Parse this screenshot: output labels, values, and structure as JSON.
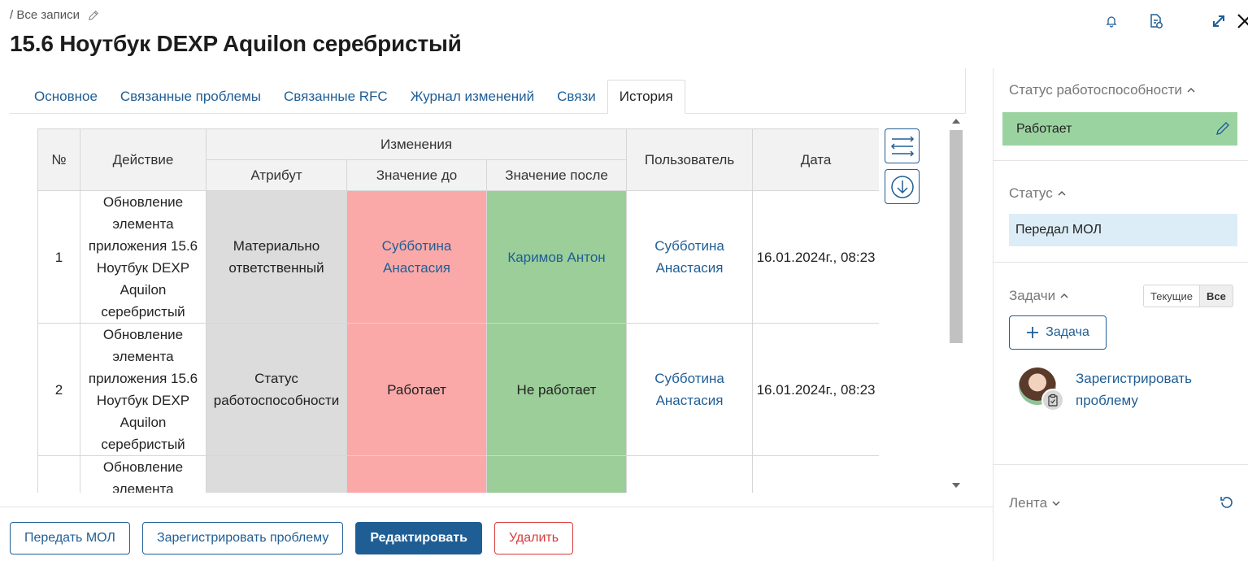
{
  "breadcrumb": {
    "text": "/ Все записи"
  },
  "title": "15.6 Ноутбук DEXP Aquilon серебристый",
  "tabs": [
    {
      "label": "Основное"
    },
    {
      "label": "Связанные проблемы"
    },
    {
      "label": "Связанные RFC"
    },
    {
      "label": "Журнал изменений"
    },
    {
      "label": "Связи"
    },
    {
      "label": "История"
    }
  ],
  "table": {
    "headers": {
      "num": "№",
      "action": "Действие",
      "changes": "Изменения",
      "attribute": "Атрибут",
      "before": "Значение до",
      "after": "Значение после",
      "user": "Пользователь",
      "date": "Дата"
    },
    "rows": [
      {
        "num": "1",
        "action": "Обновление элемента приложения 15.6 Ноутбук DEXP Aquilon серебристый",
        "attribute": "Материально ответственный",
        "before": "Субботина Анастасия",
        "after": "Каримов Антон",
        "user": "Субботина Анастасия",
        "date": "16.01.2024г., 08:23"
      },
      {
        "num": "2",
        "action": "Обновление элемента приложения 15.6 Ноутбук DEXP Aquilon серебристый",
        "attribute": "Статус работоспособности",
        "before": "Работает",
        "after": "Не работает",
        "user": "Субботина Анастасия",
        "date": "16.01.2024г., 08:23"
      },
      {
        "num": "",
        "action": "Обновление элемента",
        "attribute": "",
        "before": "",
        "after": "",
        "user": "",
        "date": ""
      }
    ]
  },
  "actions": {
    "transfer": "Передать МОЛ",
    "register": "Зарегистрировать проблему",
    "edit": "Редактировать",
    "delete": "Удалить"
  },
  "right_panel": {
    "health": {
      "title": "Статус работоспособности",
      "value": "Работает",
      "color": "#9bd3a0"
    },
    "status": {
      "title": "Статус",
      "value": "Передал МОЛ",
      "color": "#dcedf7"
    },
    "tasks": {
      "title": "Задачи",
      "filter_current": "Текущие",
      "filter_all": "Все",
      "add_label": "Задача",
      "item": "Зарегистрировать проблему"
    },
    "feed": {
      "title": "Лента"
    }
  },
  "colors": {
    "accent": "#1f5e95",
    "danger": "#d63b3b",
    "before_bg": "#fba9a8",
    "after_bg": "#9bce98",
    "attr_bg": "#dcdcdc"
  }
}
